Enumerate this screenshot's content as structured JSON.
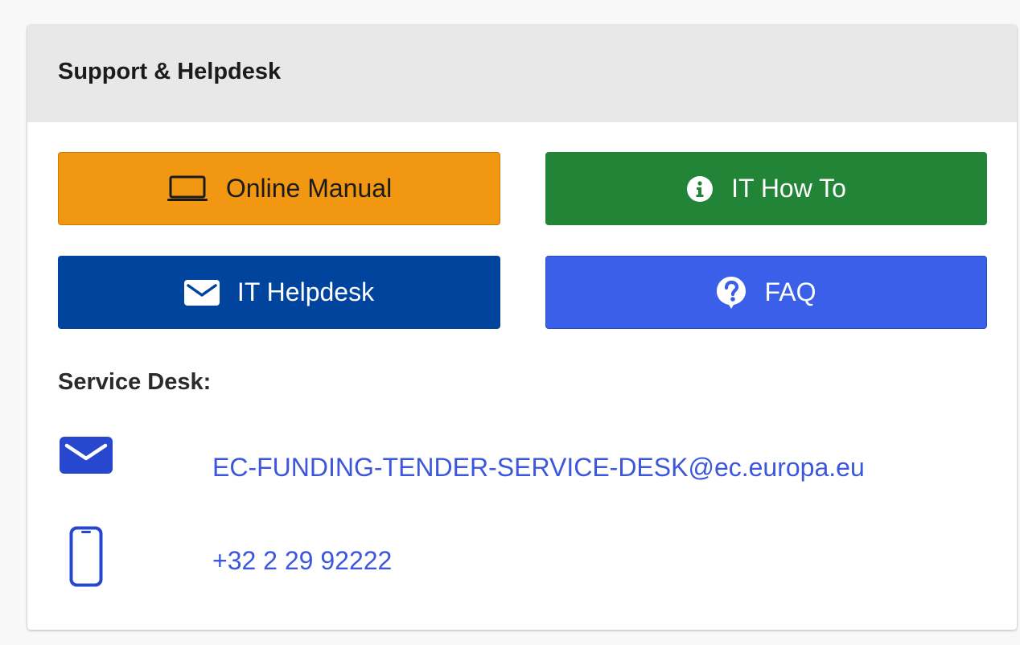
{
  "panel": {
    "title": "Support & Helpdesk"
  },
  "buttons": {
    "online_manual": {
      "label": "Online Manual",
      "icon": "laptop-icon",
      "color": "#f29712"
    },
    "it_how_to": {
      "label": "IT How To",
      "icon": "info-circle-icon",
      "color": "#228437"
    },
    "it_helpdesk": {
      "label": "IT Helpdesk",
      "icon": "envelope-icon",
      "color": "#00449e"
    },
    "faq": {
      "label": "FAQ",
      "icon": "question-bubble-icon",
      "color": "#3a5fe8"
    }
  },
  "service_desk": {
    "label": "Service Desk:",
    "email": "EC-FUNDING-TENDER-SERVICE-DESK@ec.europa.eu",
    "phone": "+32 2 29 92222",
    "link_color": "#3c56dc"
  }
}
